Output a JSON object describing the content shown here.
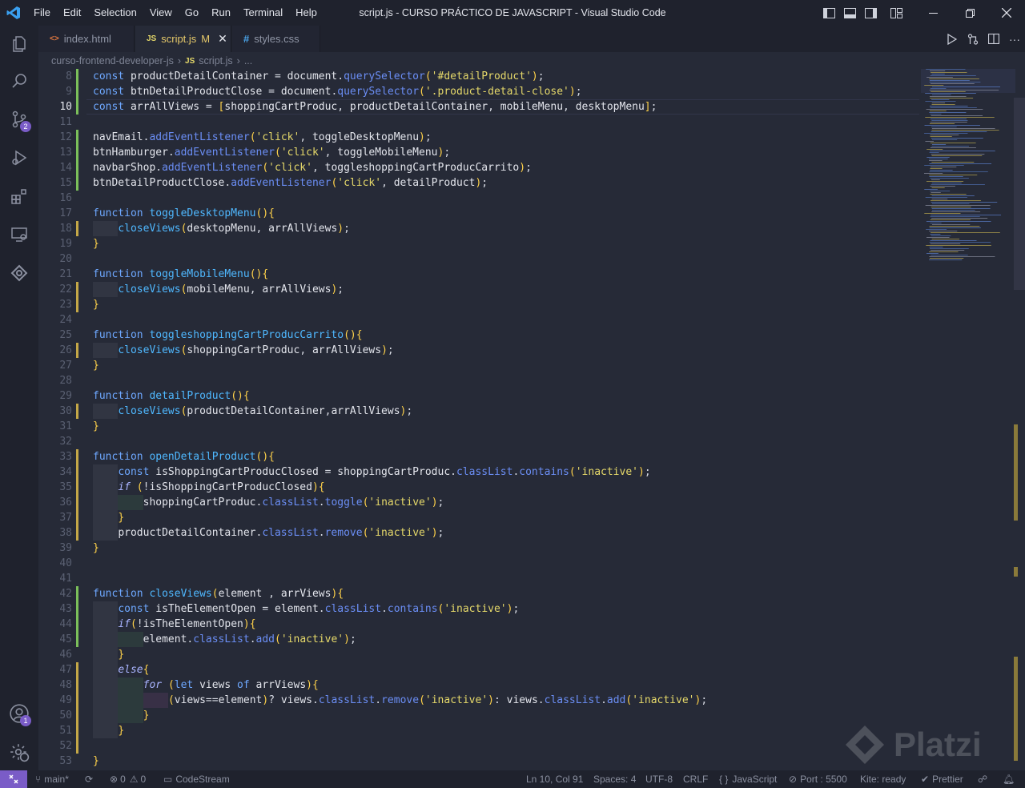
{
  "window": {
    "title": "script.js - CURSO PRÁCTICO DE JAVASCRIPT - Visual Studio Code"
  },
  "menu": [
    "File",
    "Edit",
    "Selection",
    "View",
    "Go",
    "Run",
    "Terminal",
    "Help"
  ],
  "activity": {
    "items": [
      "explorer-icon",
      "search-icon",
      "source-control-icon",
      "run-debug-icon",
      "extensions-icon",
      "remote-explorer-icon",
      "codestream-icon"
    ],
    "source_control_badge": "2",
    "accounts_badge": "1"
  },
  "tabs": [
    {
      "icon": "<>",
      "label": "index.html",
      "modified": ""
    },
    {
      "icon": "JS",
      "label": "script.js",
      "modified": "M"
    },
    {
      "icon": "#",
      "label": "styles.css",
      "modified": ""
    }
  ],
  "breadcrumb": {
    "folder": "curso-frontend-developer-js",
    "file_icon": "JS",
    "file": "script.js",
    "tail": "..."
  },
  "editor": {
    "current_line": 10,
    "lines": [
      {
        "n": 8,
        "code": "const productDetailContainer = document.querySelector('#detailProduct');"
      },
      {
        "n": 9,
        "code": "const btnDetailProductClose = document.querySelector('.product-detail-close');"
      },
      {
        "n": 10,
        "code": "const arrAllViews = [shoppingCartProduc, productDetailContainer, mobileMenu, desktopMenu];"
      },
      {
        "n": 11,
        "code": ""
      },
      {
        "n": 12,
        "code": "navEmail.addEventListener('click', toggleDesktopMenu);"
      },
      {
        "n": 13,
        "code": "btnHamburger.addEventListener('click', toggleMobileMenu);"
      },
      {
        "n": 14,
        "code": "navbarShop.addEventListener('click', toggleshoppingCartProducCarrito);"
      },
      {
        "n": 15,
        "code": "btnDetailProductClose.addEventListener('click', detailProduct);"
      },
      {
        "n": 16,
        "code": ""
      },
      {
        "n": 17,
        "code": "function toggleDesktopMenu(){"
      },
      {
        "n": 18,
        "code": "    closeViews(desktopMenu, arrAllViews);"
      },
      {
        "n": 19,
        "code": "}"
      },
      {
        "n": 20,
        "code": ""
      },
      {
        "n": 21,
        "code": "function toggleMobileMenu(){"
      },
      {
        "n": 22,
        "code": "    closeViews(mobileMenu, arrAllViews);"
      },
      {
        "n": 23,
        "code": "}"
      },
      {
        "n": 24,
        "code": ""
      },
      {
        "n": 25,
        "code": "function toggleshoppingCartProducCarrito(){"
      },
      {
        "n": 26,
        "code": "    closeViews(shoppingCartProduc, arrAllViews);"
      },
      {
        "n": 27,
        "code": "}"
      },
      {
        "n": 28,
        "code": ""
      },
      {
        "n": 29,
        "code": "function detailProduct(){"
      },
      {
        "n": 30,
        "code": "    closeViews(productDetailContainer,arrAllViews);"
      },
      {
        "n": 31,
        "code": "}"
      },
      {
        "n": 32,
        "code": ""
      },
      {
        "n": 33,
        "code": "function openDetailProduct(){"
      },
      {
        "n": 34,
        "code": "    const isShoppingCartProducClosed = shoppingCartProduc.classList.contains('inactive');"
      },
      {
        "n": 35,
        "code": "    if (!isShoppingCartProducClosed){"
      },
      {
        "n": 36,
        "code": "        shoppingCartProduc.classList.toggle('inactive');"
      },
      {
        "n": 37,
        "code": "    }"
      },
      {
        "n": 38,
        "code": "    productDetailContainer.classList.remove('inactive');"
      },
      {
        "n": 39,
        "code": "}"
      },
      {
        "n": 40,
        "code": ""
      },
      {
        "n": 41,
        "code": ""
      },
      {
        "n": 42,
        "code": "function closeViews(element , arrViews){"
      },
      {
        "n": 43,
        "code": "    const isTheElementOpen = element.classList.contains('inactive');"
      },
      {
        "n": 44,
        "code": "    if(!isTheElementOpen){"
      },
      {
        "n": 45,
        "code": "        element.classList.add('inactive');"
      },
      {
        "n": 46,
        "code": "    }"
      },
      {
        "n": 47,
        "code": "    else{"
      },
      {
        "n": 48,
        "code": "        for (let views of arrViews){"
      },
      {
        "n": 49,
        "code": "            (views==element)? views.classList.remove('inactive'): views.classList.add('inactive');"
      },
      {
        "n": 50,
        "code": "        }"
      },
      {
        "n": 51,
        "code": "    }"
      },
      {
        "n": 52,
        "code": ""
      },
      {
        "n": 53,
        "code": "}"
      }
    ]
  },
  "status": {
    "branch": "main*",
    "errors": "0",
    "warnings": "0",
    "codestream": "CodeStream",
    "cursor": "Ln 10, Col 91",
    "spaces": "Spaces: 4",
    "encoding": "UTF-8",
    "eol": "CRLF",
    "language": "JavaScript",
    "port": "Port : 5500",
    "kite": "Kite: ready",
    "prettier": "Prettier"
  },
  "watermark": {
    "text": "Platzi"
  },
  "colors": {
    "accent": "#7a5cc7",
    "background": "#262a37",
    "chrome": "#1f222d",
    "string": "#e6d96a",
    "keyword": "#6ea8ff"
  }
}
